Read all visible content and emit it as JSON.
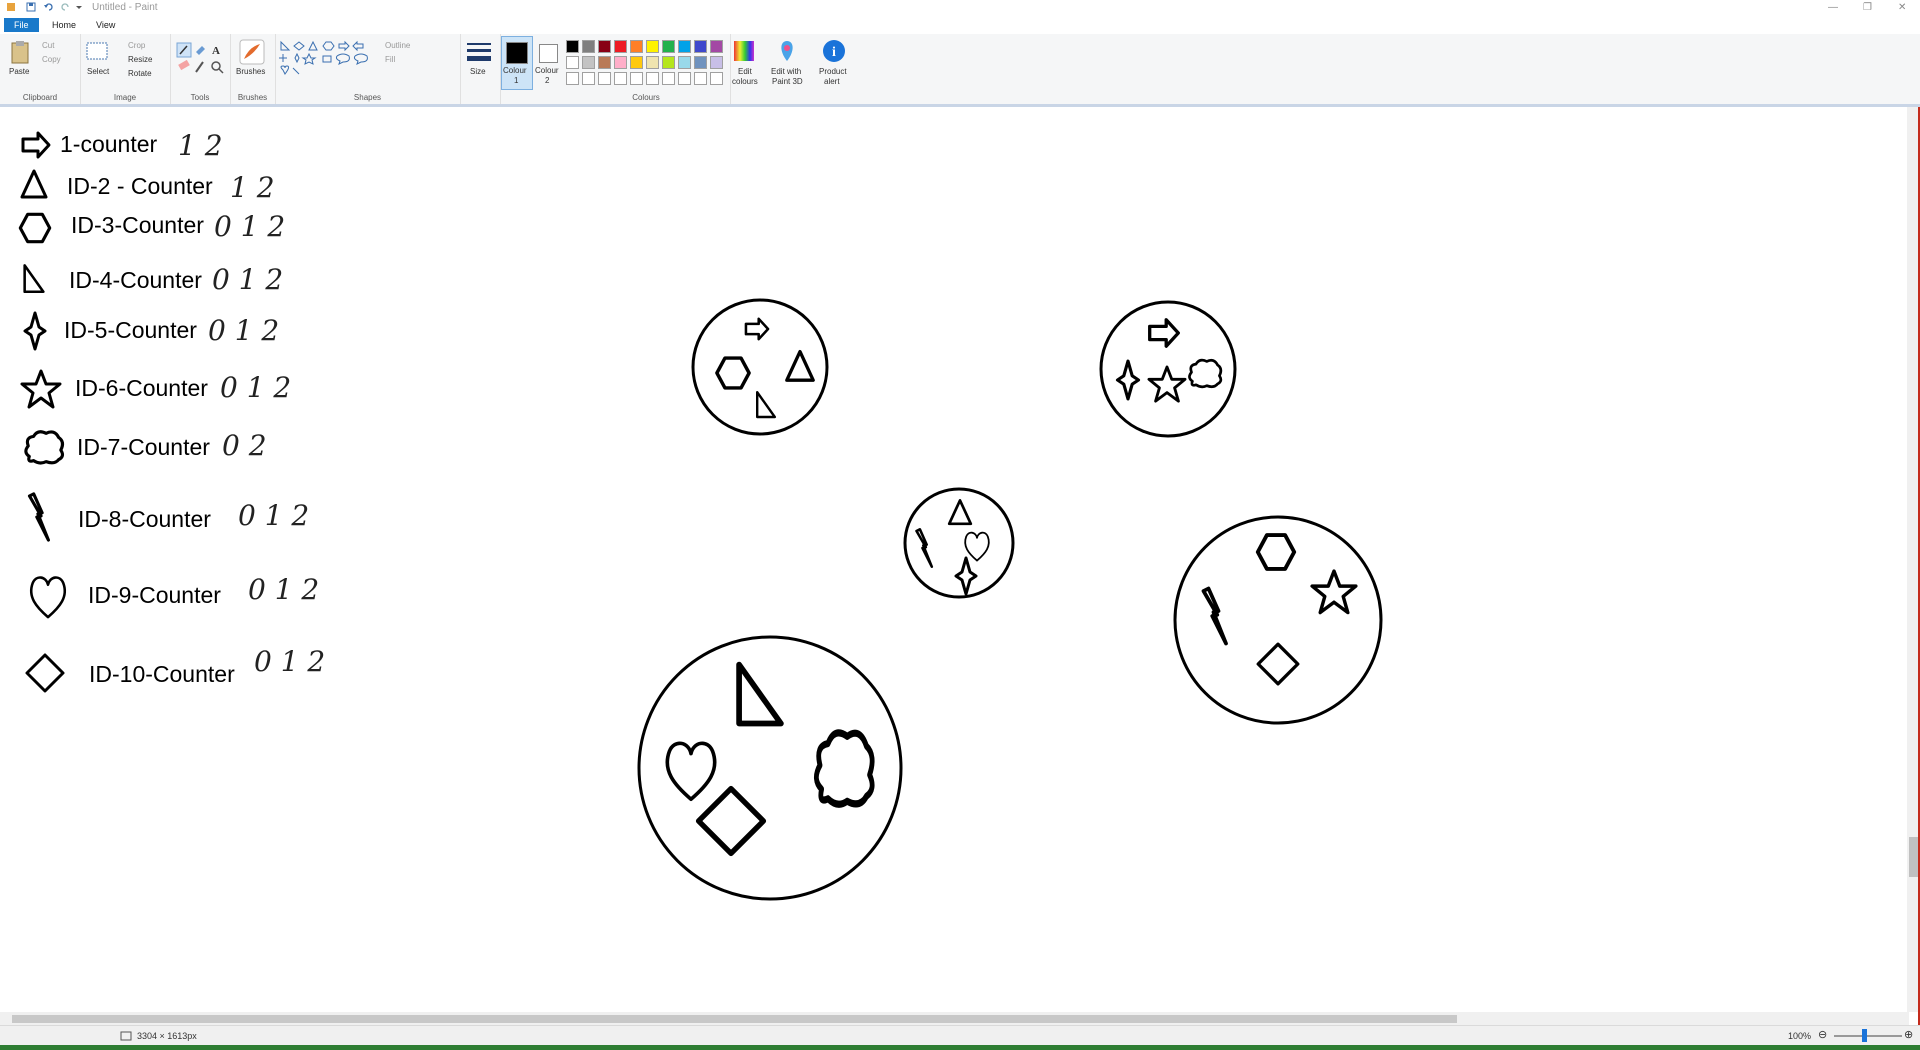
{
  "window": {
    "title": "Untitled - Paint",
    "controls": [
      "—",
      "❐",
      "✕"
    ]
  },
  "tabs": {
    "file": "File",
    "home": "Home",
    "view": "View"
  },
  "ribbon": {
    "clipboard": {
      "paste": "Paste",
      "cut": "Cut",
      "copy": "Copy",
      "label": "Clipboard"
    },
    "image": {
      "select": "Select",
      "crop": "Crop",
      "resize": "Resize",
      "rotate": "Rotate",
      "label": "Image"
    },
    "tools": {
      "label": "Tools"
    },
    "brushes": {
      "label": "Brushes"
    },
    "shapes": {
      "outline": "Outline",
      "fill": "Fill",
      "label": "Shapes"
    },
    "size": {
      "label": "Size"
    },
    "colour1": {
      "line1": "Colour",
      "line2": "1"
    },
    "colour2": {
      "line1": "Colour",
      "line2": "2"
    },
    "colours": {
      "label": "Colours",
      "palette_row1": [
        "#000000",
        "#7f7f7f",
        "#880015",
        "#ed1c24",
        "#ff7f27",
        "#fff200",
        "#22b14c",
        "#00a2e8",
        "#3f48cc",
        "#a349a4"
      ],
      "palette_row2": [
        "#ffffff",
        "#c3c3c3",
        "#b97a57",
        "#ffaec9",
        "#ffc90e",
        "#efe4b0",
        "#b5e61d",
        "#99d9ea",
        "#7092be",
        "#c8bfe7"
      ],
      "palette_row3": [
        "#ffffff",
        "#ffffff",
        "#ffffff",
        "#ffffff",
        "#ffffff",
        "#ffffff",
        "#ffffff",
        "#ffffff",
        "#ffffff",
        "#ffffff"
      ]
    },
    "edit_colours": {
      "line1": "Edit",
      "line2": "colours"
    },
    "paint3d": {
      "line1": "Edit with",
      "line2": "Paint 3D"
    },
    "product_alert": {
      "line1": "Product",
      "line2": "alert"
    }
  },
  "legend": [
    {
      "shape": "arrow-icon",
      "text": "1-counter",
      "marks": "1 2"
    },
    {
      "shape": "triangle-icon",
      "text": "ID-2 - Counter",
      "marks": "1 2"
    },
    {
      "shape": "hexagon-icon",
      "text": "ID-3-Counter",
      "marks": "0 1 2"
    },
    {
      "shape": "right-triangle-icon",
      "text": "ID-4-Counter",
      "marks": "0 1 2"
    },
    {
      "shape": "four-point-star-icon",
      "text": "ID-5-Counter",
      "marks": "0 1 2"
    },
    {
      "shape": "star-icon",
      "text": "ID-6-Counter",
      "marks": "0 1 2"
    },
    {
      "shape": "cloud-icon",
      "text": "ID-7-Counter",
      "marks": "0 2"
    },
    {
      "shape": "lightning-icon",
      "text": "ID-8-Counter",
      "marks": "0 1 2"
    },
    {
      "shape": "heart-icon",
      "text": "ID-9-Counter",
      "marks": "0 1 2"
    },
    {
      "shape": "diamond-icon",
      "text": "ID-10-Counter",
      "marks": "0 1 2"
    }
  ],
  "status": {
    "canvas_size": "3304 × 1613px",
    "zoom": "100%"
  }
}
